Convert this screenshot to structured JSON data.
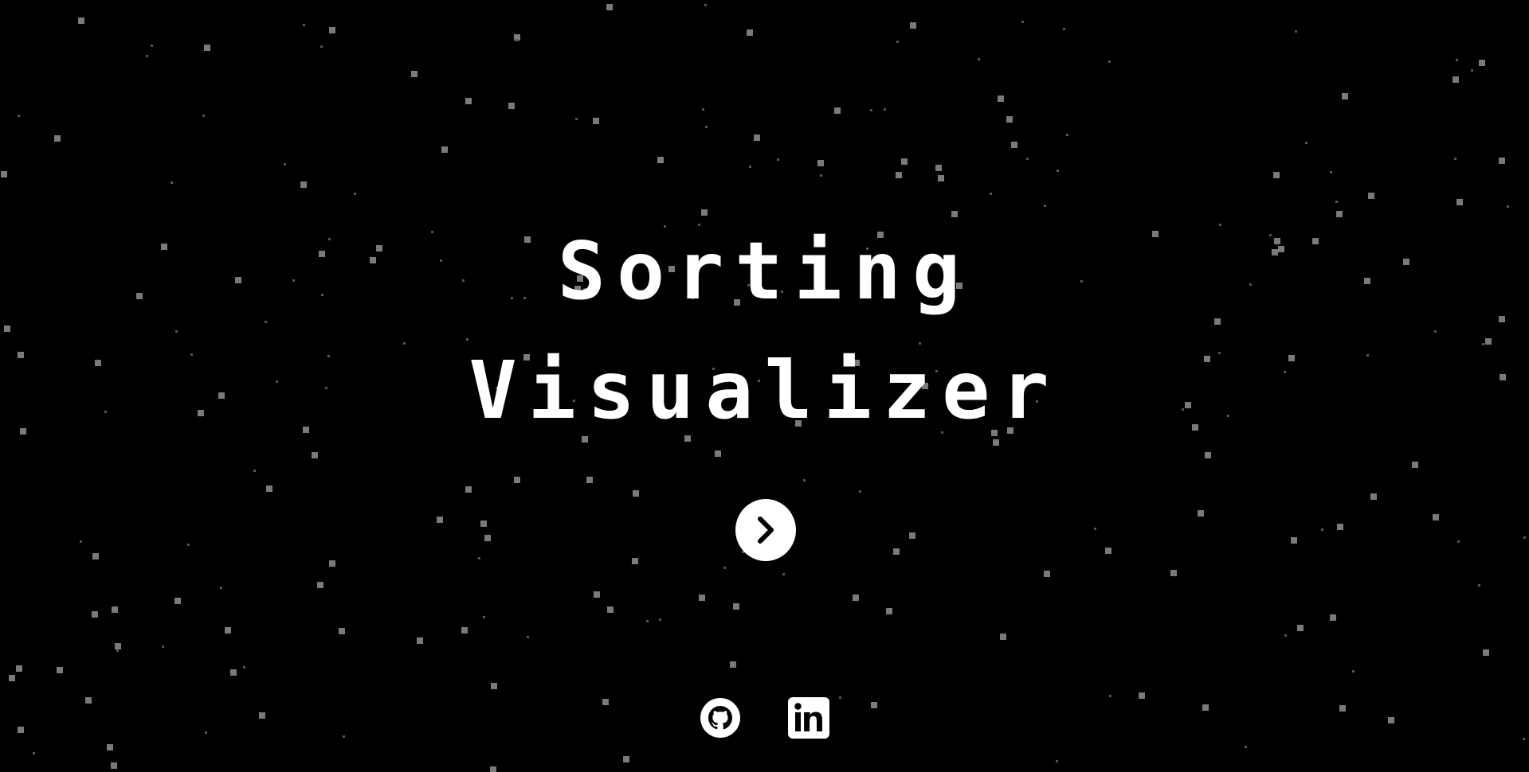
{
  "title": {
    "line1": "Sorting",
    "line2": "Visualizer"
  },
  "start_button": {
    "icon": "chevron-right-icon"
  },
  "social": {
    "github_icon": "github-icon",
    "linkedin_icon": "linkedin-icon"
  },
  "colors": {
    "background": "#000000",
    "foreground": "#ffffff",
    "star": "#777777"
  }
}
